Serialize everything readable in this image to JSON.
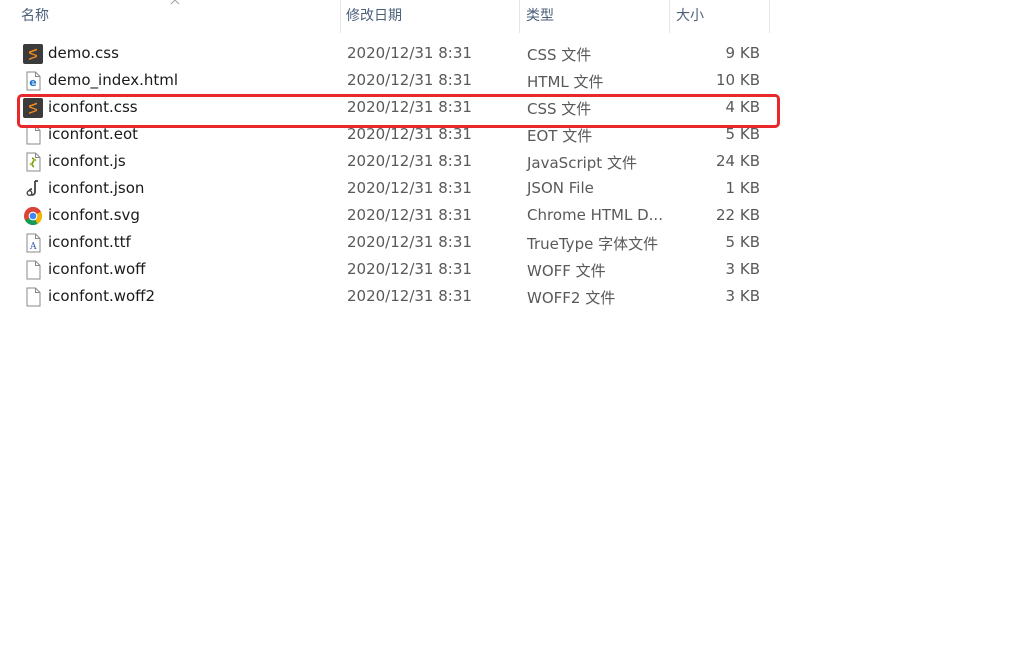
{
  "columns": {
    "name": "名称",
    "date": "修改日期",
    "type": "类型",
    "size": "大小"
  },
  "files": [
    {
      "name": "demo.css",
      "date": "2020/12/31 8:31",
      "type": "CSS 文件",
      "size": "9 KB",
      "icon": "sublime-css-icon"
    },
    {
      "name": "demo_index.html",
      "date": "2020/12/31 8:31",
      "type": "HTML 文件",
      "size": "10 KB",
      "icon": "html-file-icon"
    },
    {
      "name": "iconfont.css",
      "date": "2020/12/31 8:31",
      "type": "CSS 文件",
      "size": "4 KB",
      "icon": "sublime-css-icon"
    },
    {
      "name": "iconfont.eot",
      "date": "2020/12/31 8:31",
      "type": "EOT 文件",
      "size": "5 KB",
      "icon": "blank-file-icon"
    },
    {
      "name": "iconfont.js",
      "date": "2020/12/31 8:31",
      "type": "JavaScript 文件",
      "size": "24 KB",
      "icon": "javascript-file-icon"
    },
    {
      "name": "iconfont.json",
      "date": "2020/12/31 8:31",
      "type": "JSON File",
      "size": "1 KB",
      "icon": "json-file-icon"
    },
    {
      "name": "iconfont.svg",
      "date": "2020/12/31 8:31",
      "type": "Chrome HTML D...",
      "size": "22 KB",
      "icon": "chrome-icon"
    },
    {
      "name": "iconfont.ttf",
      "date": "2020/12/31 8:31",
      "type": "TrueType 字体文件",
      "size": "5 KB",
      "icon": "truetype-font-icon"
    },
    {
      "name": "iconfont.woff",
      "date": "2020/12/31 8:31",
      "type": "WOFF 文件",
      "size": "3 KB",
      "icon": "blank-file-icon"
    },
    {
      "name": "iconfont.woff2",
      "date": "2020/12/31 8:31",
      "type": "WOFF2 文件",
      "size": "3 KB",
      "icon": "blank-file-icon"
    }
  ],
  "highlighted_file": "iconfont.css",
  "colors": {
    "highlight_border": "#e8282b",
    "header_text": "#4c607a",
    "sublime_orange": "#f48a1f"
  }
}
